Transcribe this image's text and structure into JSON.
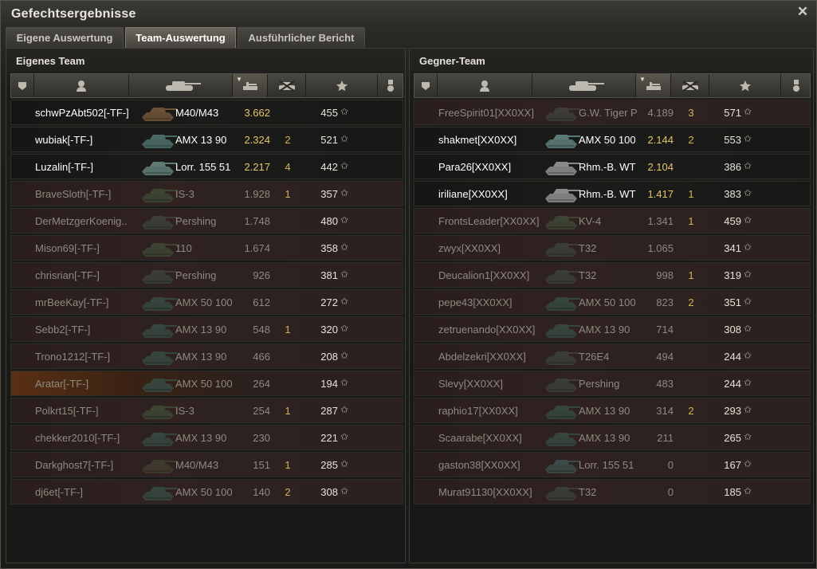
{
  "window": {
    "title": "Gefechtsergebnisse",
    "close_label": "✕"
  },
  "tabs": [
    {
      "label": "Eigene Auswertung"
    },
    {
      "label": "Team-Auswertung"
    },
    {
      "label": "Ausführlicher Bericht"
    }
  ],
  "active_tab": 1,
  "columns": [
    "platoon-icon",
    "player-icon",
    "tank-icon",
    "damage-icon",
    "kills-icon",
    "xp-star-icon",
    "medal-icon"
  ],
  "sorted_column_arrow": "▼",
  "xp_icon_glyph": "✩",
  "colors": {
    "name_alive": "#ffffff",
    "name_dead": "#8d8a81",
    "damage_highlight": "#e5c46a",
    "kills": "#d4b25c",
    "self_row": "#5a3014"
  },
  "own_team": {
    "title": "Eigenes Team",
    "rows": [
      {
        "name": "schwPzAbt502[-TF-]",
        "vehicle": "M40/M43",
        "damage": "3.662",
        "kills": "",
        "xp": "455",
        "alive": true,
        "tank_color": "#6b5236"
      },
      {
        "name": "wubiak[-TF-]",
        "vehicle": "AMX 13 90",
        "damage": "2.324",
        "kills": "2",
        "xp": "521",
        "alive": true,
        "tank_color": "#4a6a66"
      },
      {
        "name": "Luzalin[-TF-]",
        "vehicle": "Lorr. 155 51",
        "damage": "2.217",
        "kills": "4",
        "xp": "442",
        "alive": true,
        "tank_color": "#5f7a74"
      },
      {
        "name": "BraveSloth[-TF-]",
        "vehicle": "IS-3",
        "damage": "1.928",
        "kills": "1",
        "xp": "357",
        "alive": false,
        "tank_color": "#3d4433"
      },
      {
        "name": "DerMetzgerKoenig..",
        "vehicle": "Pershing",
        "damage": "1.748",
        "kills": "",
        "xp": "480",
        "alive": false,
        "tank_color": "#3a3e35"
      },
      {
        "name": "Mison69[-TF-]",
        "vehicle": "110",
        "damage": "1.674",
        "kills": "",
        "xp": "358",
        "alive": false,
        "tank_color": "#3d4433"
      },
      {
        "name": "chrisrian[-TF-]",
        "vehicle": "Pershing",
        "damage": "926",
        "kills": "",
        "xp": "381",
        "alive": false,
        "tank_color": "#3a3e35"
      },
      {
        "name": "mrBeeKay[-TF-]",
        "vehicle": "AMX 50 100",
        "damage": "612",
        "kills": "",
        "xp": "272",
        "alive": false,
        "tank_color": "#36463f"
      },
      {
        "name": "Sebb2[-TF-]",
        "vehicle": "AMX 13 90",
        "damage": "548",
        "kills": "1",
        "xp": "320",
        "alive": false,
        "tank_color": "#36463f"
      },
      {
        "name": "Trono1212[-TF-]",
        "vehicle": "AMX 13 90",
        "damage": "466",
        "kills": "",
        "xp": "208",
        "alive": false,
        "tank_color": "#36463f"
      },
      {
        "name": "Aratar[-TF-]",
        "vehicle": "AMX 50 100",
        "damage": "264",
        "kills": "",
        "xp": "194",
        "alive": false,
        "self": true,
        "tank_color": "#36463f"
      },
      {
        "name": "Polkrt15[-TF-]",
        "vehicle": "IS-3",
        "damage": "254",
        "kills": "1",
        "xp": "287",
        "alive": false,
        "tank_color": "#3d4433"
      },
      {
        "name": "chekker2010[-TF-]",
        "vehicle": "AMX 13 90",
        "damage": "230",
        "kills": "",
        "xp": "221",
        "alive": false,
        "tank_color": "#36463f"
      },
      {
        "name": "Darkghost7[-TF-]",
        "vehicle": "M40/M43",
        "damage": "151",
        "kills": "1",
        "xp": "285",
        "alive": false,
        "tank_color": "#3f3a2e"
      },
      {
        "name": "dj6et[-TF-]",
        "vehicle": "AMX 50 100",
        "damage": "140",
        "kills": "2",
        "xp": "308",
        "alive": false,
        "tank_color": "#36463f"
      }
    ]
  },
  "enemy_team": {
    "title": "Gegner-Team",
    "rows": [
      {
        "name": "FreeSpirit01[XX0XX]",
        "vehicle": "G.W. Tiger P",
        "damage": "4.189",
        "kills": "3",
        "xp": "571",
        "alive": false,
        "tank_color": "#3c3c38"
      },
      {
        "name": "shakmet[XX0XX]",
        "vehicle": "AMX 50 100",
        "damage": "2.144",
        "kills": "2",
        "xp": "553",
        "alive": true,
        "tank_color": "#5a7a76"
      },
      {
        "name": "Para26[XX0XX]",
        "vehicle": "Rhm.-B. WT",
        "damage": "2.104",
        "kills": "",
        "xp": "386",
        "alive": true,
        "tank_color": "#8a8a88"
      },
      {
        "name": "iriliane[XX0XX]",
        "vehicle": "Rhm.-B. WT",
        "damage": "1.417",
        "kills": "1",
        "xp": "383",
        "alive": true,
        "tank_color": "#8a8a88"
      },
      {
        "name": "FrontsLeader[XX0XX]",
        "vehicle": "KV-4",
        "damage": "1.341",
        "kills": "1",
        "xp": "459",
        "alive": false,
        "tank_color": "#3d4433"
      },
      {
        "name": "zwyx[XX0XX]",
        "vehicle": "T32",
        "damage": "1.065",
        "kills": "",
        "xp": "341",
        "alive": false,
        "tank_color": "#3a3e35"
      },
      {
        "name": "Deucalion1[XX0XX]",
        "vehicle": "T32",
        "damage": "998",
        "kills": "1",
        "xp": "319",
        "alive": false,
        "tank_color": "#3a3e35"
      },
      {
        "name": "pepe43[XX0XX]",
        "vehicle": "AMX 50 100",
        "damage": "823",
        "kills": "2",
        "xp": "351",
        "alive": false,
        "tank_color": "#36463f"
      },
      {
        "name": "zetruenando[XX0XX]",
        "vehicle": "AMX 13 90",
        "damage": "714",
        "kills": "",
        "xp": "308",
        "alive": false,
        "tank_color": "#36463f"
      },
      {
        "name": "Abdelzekri[XX0XX]",
        "vehicle": "T26E4",
        "damage": "494",
        "kills": "",
        "xp": "244",
        "alive": false,
        "tank_color": "#3a3e35"
      },
      {
        "name": "Slevy[XX0XX]",
        "vehicle": "Pershing",
        "damage": "483",
        "kills": "",
        "xp": "244",
        "alive": false,
        "tank_color": "#3a3e35"
      },
      {
        "name": "raphio17[XX0XX]",
        "vehicle": "AMX 13 90",
        "damage": "314",
        "kills": "2",
        "xp": "293",
        "alive": false,
        "tank_color": "#36463f"
      },
      {
        "name": "Scaarabe[XX0XX]",
        "vehicle": "AMX 13 90",
        "damage": "211",
        "kills": "",
        "xp": "265",
        "alive": false,
        "tank_color": "#36463f"
      },
      {
        "name": "gaston38[XX0XX]",
        "vehicle": "Lorr. 155 51",
        "damage": "0",
        "kills": "",
        "xp": "167",
        "alive": false,
        "tank_color": "#3c4a48"
      },
      {
        "name": "Murat91130[XX0XX]",
        "vehicle": "T32",
        "damage": "0",
        "kills": "",
        "xp": "185",
        "alive": false,
        "tank_color": "#3a3e35"
      }
    ]
  }
}
